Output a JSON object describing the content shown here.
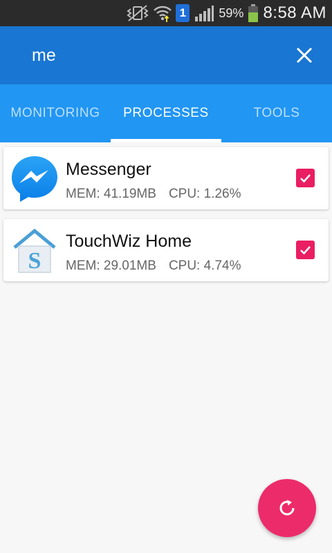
{
  "status_bar": {
    "battery_percent": "59%",
    "time": "8:58 AM",
    "sim_label": "1",
    "icons": [
      "vibrate-icon",
      "wifi-icon",
      "sim-icon",
      "signal-icon",
      "battery-icon"
    ],
    "battery_color": "#8bc34a"
  },
  "search": {
    "value": "me",
    "close_icon": "close-icon"
  },
  "tabs": [
    {
      "label": "MONITORING",
      "active": false
    },
    {
      "label": "PROCESSES",
      "active": true
    },
    {
      "label": "TOOLS",
      "active": false
    }
  ],
  "processes": [
    {
      "name": "Messenger",
      "mem": "MEM: 41.19MB",
      "cpu": "CPU: 1.26%",
      "icon": "messenger-icon",
      "checked": true
    },
    {
      "name": "TouchWiz Home",
      "mem": "MEM: 29.01MB",
      "cpu": "CPU: 4.74%",
      "icon": "touchwiz-home-icon",
      "checked": true
    }
  ],
  "fab": {
    "icon": "refresh-icon"
  },
  "colors": {
    "search_bar": "#1976d2",
    "tab_bar": "#2196f3",
    "accent": "#e91e63",
    "fab": "#ec2b6a",
    "status_bar": "#2b2b2b"
  }
}
